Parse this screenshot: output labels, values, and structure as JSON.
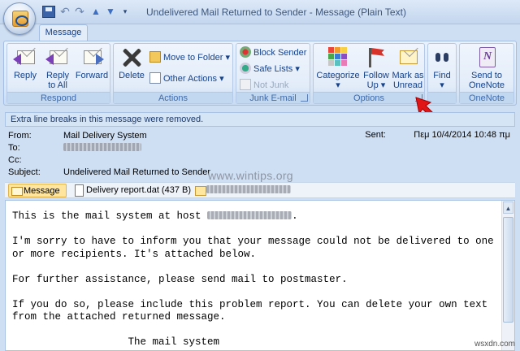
{
  "window": {
    "title": "Undelivered Mail Returned to Sender - Message (Plain Text)"
  },
  "ribbon": {
    "tab": "Message",
    "groups": {
      "respond": {
        "label": "Respond",
        "reply": "Reply",
        "reply_all_1": "Reply",
        "reply_all_2": "to All",
        "forward": "Forward"
      },
      "actions": {
        "label": "Actions",
        "delete": "Delete",
        "move_to_folder": "Move to Folder",
        "other_actions": "Other Actions"
      },
      "junk": {
        "label": "Junk E-mail",
        "block_sender": "Block Sender",
        "safe_lists": "Safe Lists",
        "not_junk": "Not Junk"
      },
      "options": {
        "label": "Options",
        "categorize": "Categorize",
        "follow_up_1": "Follow",
        "follow_up_2": "Up",
        "mark_unread_1": "Mark as",
        "mark_unread_2": "Unread"
      },
      "find": {
        "label": "",
        "find": "Find"
      },
      "onenote": {
        "label": "OneNote",
        "send_1": "Send to",
        "send_2": "OneNote"
      }
    }
  },
  "infobar": "Extra line breaks in this message were removed.",
  "header": {
    "from_label": "From:",
    "from": "Mail Delivery System",
    "to_label": "To:",
    "cc_label": "Cc:",
    "subject_label": "Subject:",
    "subject": "Undelivered Mail Returned to Sender",
    "sent_label": "Sent:",
    "sent": "Πεμ 10/4/2014 10:48 πμ"
  },
  "watermark": "www.wintips.org",
  "attachments": {
    "message": "Message",
    "report": "Delivery report.dat (437 B)"
  },
  "body": {
    "line1": "This is the mail system at host",
    "line2": "I'm sorry to have to inform you that your message could not be delivered to one",
    "line3": "or more recipients. It's attached below.",
    "line4": "For further assistance, please send mail to postmaster.",
    "line5": "If you do so, please include this problem report. You can delete your own text",
    "line6": "from the attached returned message.",
    "line7": "                   The mail system"
  },
  "site_mark": "wsxdn.com",
  "colors": {
    "accent": "#15428b",
    "ribbon_bg": "#dbe7f7",
    "pointer": "#e01616"
  }
}
